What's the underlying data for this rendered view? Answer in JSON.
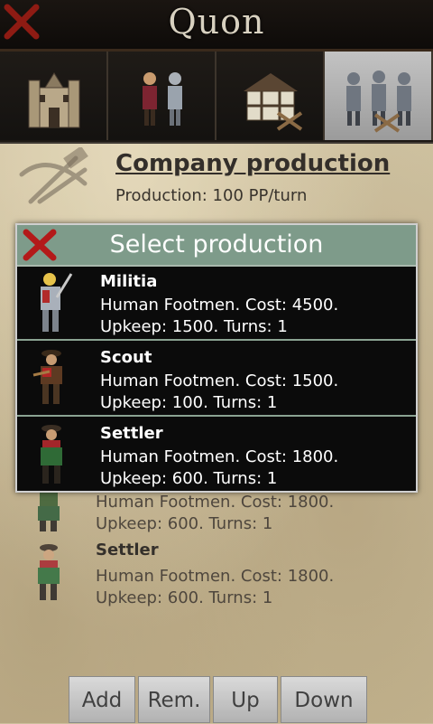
{
  "app": {
    "title": "Quon"
  },
  "tabs": [
    {
      "name": "buildings",
      "icon": "castle-icon"
    },
    {
      "name": "heroes",
      "icon": "knights-icon"
    },
    {
      "name": "construction",
      "icon": "house-build-icon"
    },
    {
      "name": "company-production",
      "icon": "army-icon",
      "active": true
    }
  ],
  "company": {
    "title": "Company production",
    "production": "Production: 100 PP/turn"
  },
  "queue": [
    {
      "name": "",
      "line1": "Human Footmen. Cost: 1800.",
      "line2": "Upkeep: 600. Turns: 1"
    },
    {
      "name": "Settler",
      "line1": "Human Footmen. Cost: 1800.",
      "line2": "Upkeep: 600. Turns: 1"
    }
  ],
  "buttons": {
    "add": "Add",
    "remove": "Rem.",
    "up": "Up",
    "down": "Down"
  },
  "dialog": {
    "title": "Select production",
    "options": [
      {
        "name": "Militia",
        "line1": "Human Footmen. Cost: 4500.",
        "line2": "Upkeep: 1500. Turns: 1"
      },
      {
        "name": "Scout",
        "line1": "Human Footmen. Cost: 1500.",
        "line2": "Upkeep: 100. Turns: 1"
      },
      {
        "name": "Settler",
        "line1": "Human Footmen. Cost: 1800.",
        "line2": "Upkeep: 600. Turns: 1"
      }
    ]
  },
  "colors": {
    "dialog_header": "#7e9b8a",
    "close_red": "#b31a1a",
    "titlebar": "#0e0b09"
  }
}
